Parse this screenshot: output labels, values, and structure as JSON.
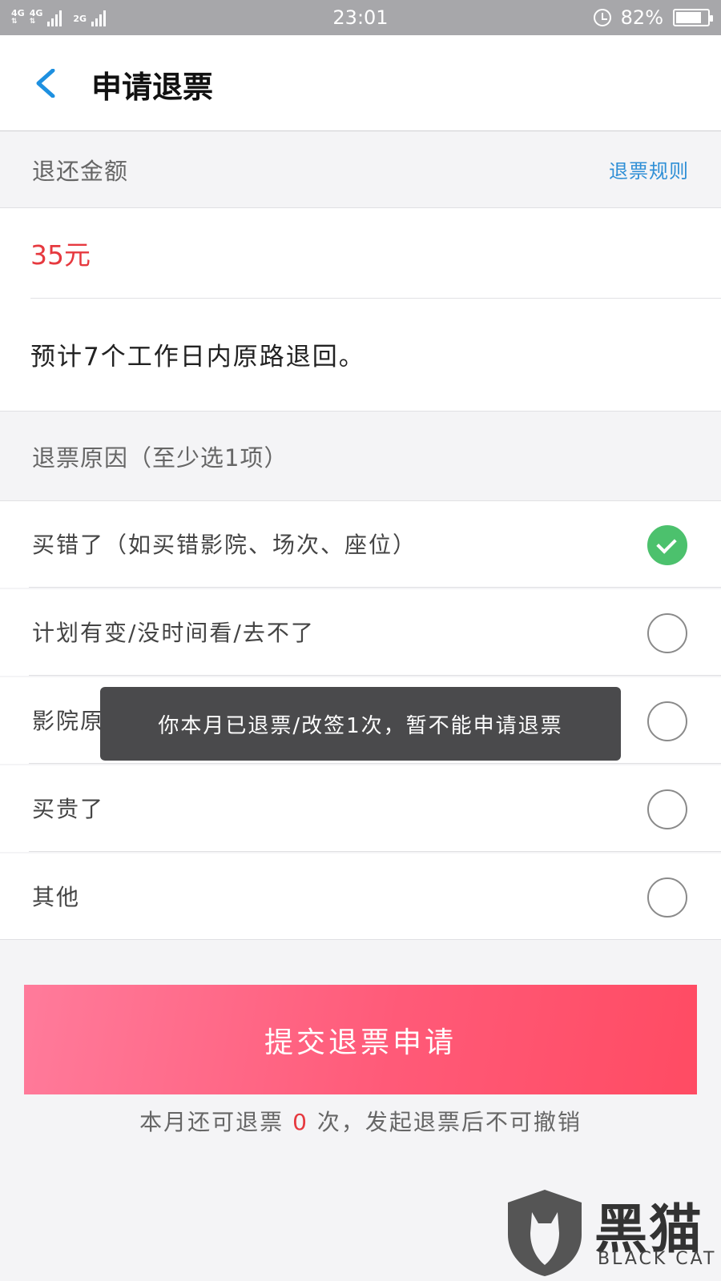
{
  "status_bar": {
    "network_1": "4G",
    "network_2": "4G",
    "network_3": "2G",
    "time": "23:01",
    "battery_percent_text": "82%",
    "battery_level": 0.82
  },
  "header": {
    "title": "申请退票"
  },
  "refund": {
    "section_label": "退还金额",
    "rules_link": "退票规则",
    "amount": "35元",
    "notice": "预计7个工作日内原路退回。"
  },
  "reasons": {
    "section_label": "退票原因（至少选1项）",
    "items": [
      {
        "label": "买错了（如买错影院、场次、座位）",
        "checked": true
      },
      {
        "label": "计划有变/没时间看/去不了",
        "checked": false
      },
      {
        "label": "影院原因",
        "checked": false
      },
      {
        "label": "买贵了",
        "checked": false
      },
      {
        "label": "其他",
        "checked": false
      }
    ]
  },
  "toast": {
    "message": "你本月已退票/改签1次，暂不能申请退票"
  },
  "submit": {
    "label": "提交退票申请"
  },
  "footnote": {
    "prefix": "本月还可退票",
    "count": "0",
    "suffix": "次，发起退票后不可撤销"
  },
  "watermark": {
    "cn": "黑猫",
    "en": "BLACK CAT"
  },
  "colors": {
    "accent_red": "#e6393f",
    "link_blue": "#2f8fd6",
    "check_green": "#4cc16d",
    "button_pink": "#ff5a78"
  }
}
